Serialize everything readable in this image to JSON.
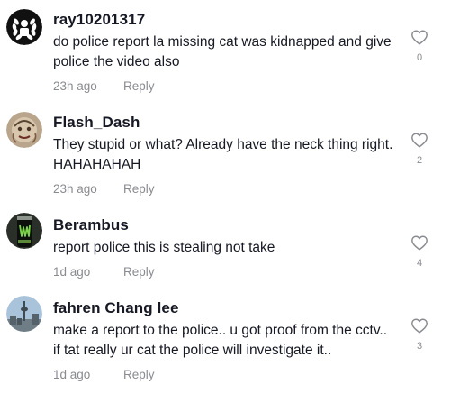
{
  "comments": [
    {
      "username": "ray10201317",
      "text": "do police report la missing cat was kidnapped and give police the video also",
      "time": "23h ago",
      "reply": "Reply",
      "likes": "0",
      "avatar_icon": "laurel-wreath-icon"
    },
    {
      "username": "Flash_Dash",
      "text": "They stupid or what? Already have the neck thing right. HAHAHAHAH",
      "time": "23h ago",
      "reply": "Reply",
      "likes": "2",
      "avatar_icon": "sketch-face-avatar"
    },
    {
      "username": "Berambus",
      "text": "report police this is stealing not take",
      "time": "1d ago",
      "reply": "Reply",
      "likes": "4",
      "avatar_icon": "energy-drink-can-avatar"
    },
    {
      "username": "fahren Chang lee",
      "text": "make a report to the police.. u got proof from the cctv.. if tat really ur cat the police will investigate it..",
      "time": "1d ago",
      "reply": "Reply",
      "likes": "3",
      "avatar_icon": "city-tower-avatar"
    }
  ],
  "colors": {
    "primary_text": "#161823",
    "secondary_text": "#8a8b91"
  }
}
